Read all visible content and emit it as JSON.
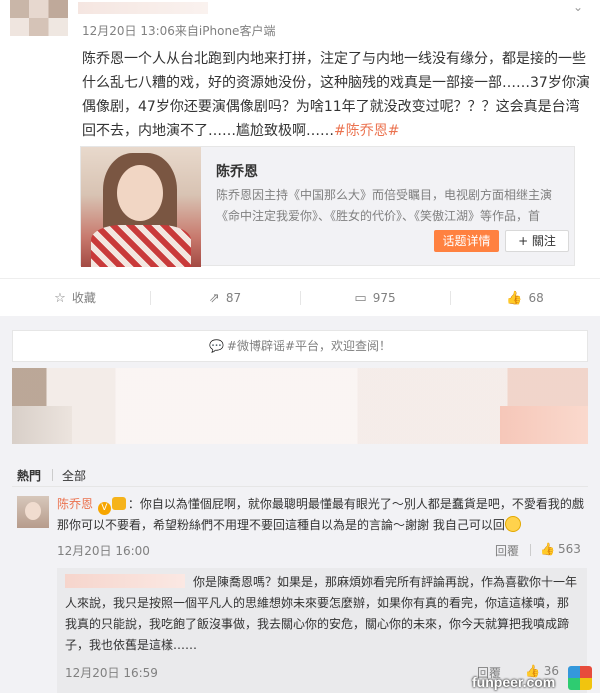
{
  "post": {
    "meta": "12月20日 13:06来自iPhone客户端",
    "text": "陈乔恩一个人从台北跑到内地来打拼，注定了与内地一线没有缘分，都是接的一些什么乱七八糟的戏，好的资源她没份，这种脑残的戏真是一部接一部……37岁你演偶像剧，47岁你还要演偶像剧吗？为啥11年了就没改变过呢？？？这会真是台湾回不去，内地演不了……尴尬致极啊……",
    "topic": "#陈乔恩#",
    "chevron": "⌄"
  },
  "card": {
    "title": "陈乔恩",
    "desc": "陈乔恩因主持《中国那么大》而倍受瞩目，电视剧方面相继主演《命中注定我爱你》、《胜女的代价》、《笑傲江湖》等作品，首",
    "detail_button": "话题详情",
    "follow_button": "+ 關注"
  },
  "actions": {
    "favorite": {
      "icon": "☆",
      "label": "收藏"
    },
    "share": {
      "icon": "⇗",
      "label": "87"
    },
    "comment": {
      "icon": "▭",
      "label": "975"
    },
    "like": {
      "icon": "👍",
      "label": "68"
    }
  },
  "comments": {
    "notice_icon": "💬",
    "notice": "#微博辟谣#平台，欢迎查阅！",
    "tab_hot": "熱門",
    "tab_all": "全部",
    "top_comment": {
      "name": "陈乔恩",
      "vbadge": "V",
      "text": "：你自以為懂個屁啊，就你最聰明最懂最有眼光了～別人都是蠢貨是吧，不愛看我的戲那你可以不要看，希望粉絲們不用理不要回這種自以為是的言論～謝謝 我自己可以回",
      "time": "12月20日 16:00",
      "reply": "回覆",
      "like_icon": "👍",
      "likes": "563"
    },
    "reply": {
      "text": "你是陳喬恩嗎？如果是，那麻煩妳看完所有評論再說，作為喜歡你十一年人來說，我只是按照一個平凡人的思維想妳未來要怎麼辦，如果你有真的看完，你這這樣噴，那我真的只能說，我吃飽了飯沒事做，我去關心你的安危，關心你的未來，你今天就算把我噴成蹄子，我也依舊是這樣……",
      "time": "12月20日 16:59",
      "reply": "回覆",
      "likes": "36"
    }
  },
  "watermark": "funpeer.com"
}
